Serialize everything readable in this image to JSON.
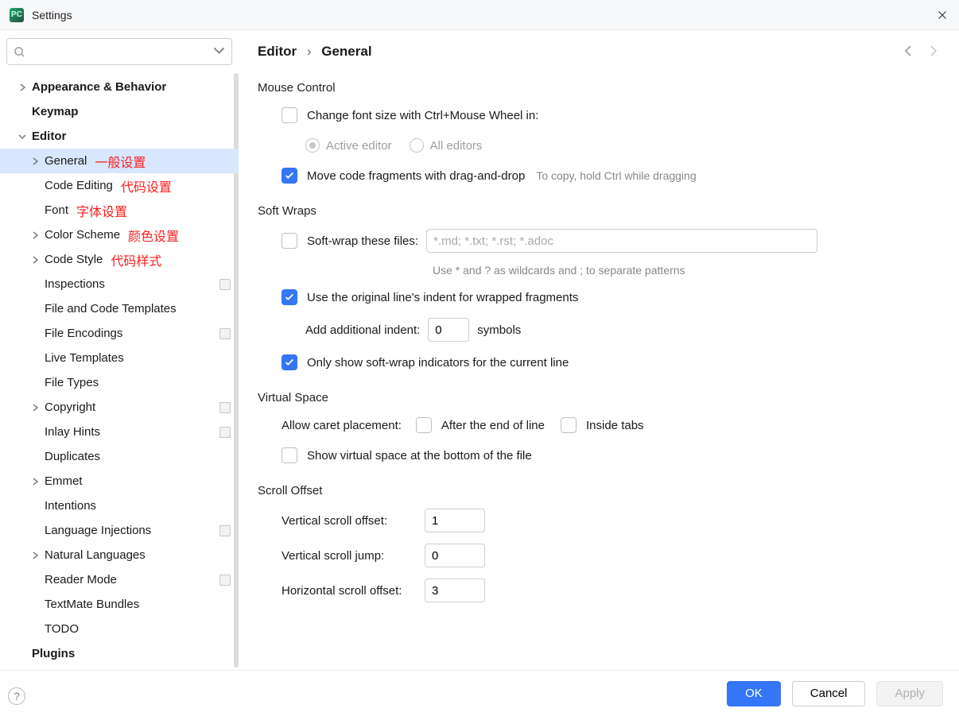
{
  "window": {
    "title": "Settings"
  },
  "crumb": {
    "root": "Editor",
    "sep": "›",
    "current": "General"
  },
  "sidebar": {
    "search_placeholder": "",
    "items": [
      {
        "label": "Appearance & Behavior",
        "bold": true,
        "expandable": true,
        "indent": 1
      },
      {
        "label": "Keymap",
        "bold": true,
        "indent": 1
      },
      {
        "label": "Editor",
        "bold": true,
        "expandable": true,
        "expanded": true,
        "indent": 1
      },
      {
        "label": "General",
        "indent": 2,
        "expandable": true,
        "selected": true,
        "annot": "一般设置"
      },
      {
        "label": "Code Editing",
        "indent": 2,
        "annot": "代码设置"
      },
      {
        "label": "Font",
        "indent": 2,
        "annot": "字体设置"
      },
      {
        "label": "Color Scheme",
        "indent": 2,
        "expandable": true,
        "annot": "颜色设置"
      },
      {
        "label": "Code Style",
        "indent": 2,
        "expandable": true,
        "annot": "代码样式"
      },
      {
        "label": "Inspections",
        "indent": 2,
        "badge": true
      },
      {
        "label": "File and Code Templates",
        "indent": 2
      },
      {
        "label": "File Encodings",
        "indent": 2,
        "badge": true
      },
      {
        "label": "Live Templates",
        "indent": 2
      },
      {
        "label": "File Types",
        "indent": 2
      },
      {
        "label": "Copyright",
        "indent": 2,
        "expandable": true,
        "badge": true
      },
      {
        "label": "Inlay Hints",
        "indent": 2,
        "badge": true
      },
      {
        "label": "Duplicates",
        "indent": 2
      },
      {
        "label": "Emmet",
        "indent": 2,
        "expandable": true
      },
      {
        "label": "Intentions",
        "indent": 2
      },
      {
        "label": "Language Injections",
        "indent": 2,
        "badge": true
      },
      {
        "label": "Natural Languages",
        "indent": 2,
        "expandable": true
      },
      {
        "label": "Reader Mode",
        "indent": 2,
        "badge": true
      },
      {
        "label": "TextMate Bundles",
        "indent": 2
      },
      {
        "label": "TODO",
        "indent": 2
      },
      {
        "label": "Plugins",
        "bold": true,
        "indent": 1
      }
    ]
  },
  "mouse": {
    "title": "Mouse Control",
    "change_font": {
      "label": "Change font size with Ctrl+Mouse Wheel in:",
      "checked": false
    },
    "active_editor": "Active editor",
    "all_editors": "All editors",
    "move_fragments": {
      "label": "Move code fragments with drag-and-drop",
      "checked": true
    },
    "copy_hint": "To copy, hold Ctrl while dragging"
  },
  "wraps": {
    "title": "Soft Wraps",
    "soft_wrap": {
      "label": "Soft-wrap these files:",
      "checked": false,
      "placeholder": "*.md; *.txt; *.rst; *.adoc"
    },
    "wildcard_hint": "Use * and ? as wildcards and ; to separate patterns",
    "original_indent": {
      "label": "Use the original line's indent for wrapped fragments",
      "checked": true
    },
    "add_indent_label": "Add additional indent:",
    "add_indent_value": "0",
    "symbols": "symbols",
    "only_show": {
      "label": "Only show soft-wrap indicators for the current line",
      "checked": true
    }
  },
  "virtual": {
    "title": "Virtual Space",
    "allow_label": "Allow caret placement:",
    "after_eol": {
      "label": "After the end of line",
      "checked": false
    },
    "inside_tabs": {
      "label": "Inside tabs",
      "checked": false
    },
    "show_bottom": {
      "label": "Show virtual space at the bottom of the file",
      "checked": false
    }
  },
  "scroll": {
    "title": "Scroll Offset",
    "v_offset_label": "Vertical scroll offset:",
    "v_offset_value": "1",
    "v_jump_label": "Vertical scroll jump:",
    "v_jump_value": "0",
    "h_offset_label": "Horizontal scroll offset:",
    "h_offset_value": "3"
  },
  "buttons": {
    "ok": "OK",
    "cancel": "Cancel",
    "apply": "Apply"
  }
}
